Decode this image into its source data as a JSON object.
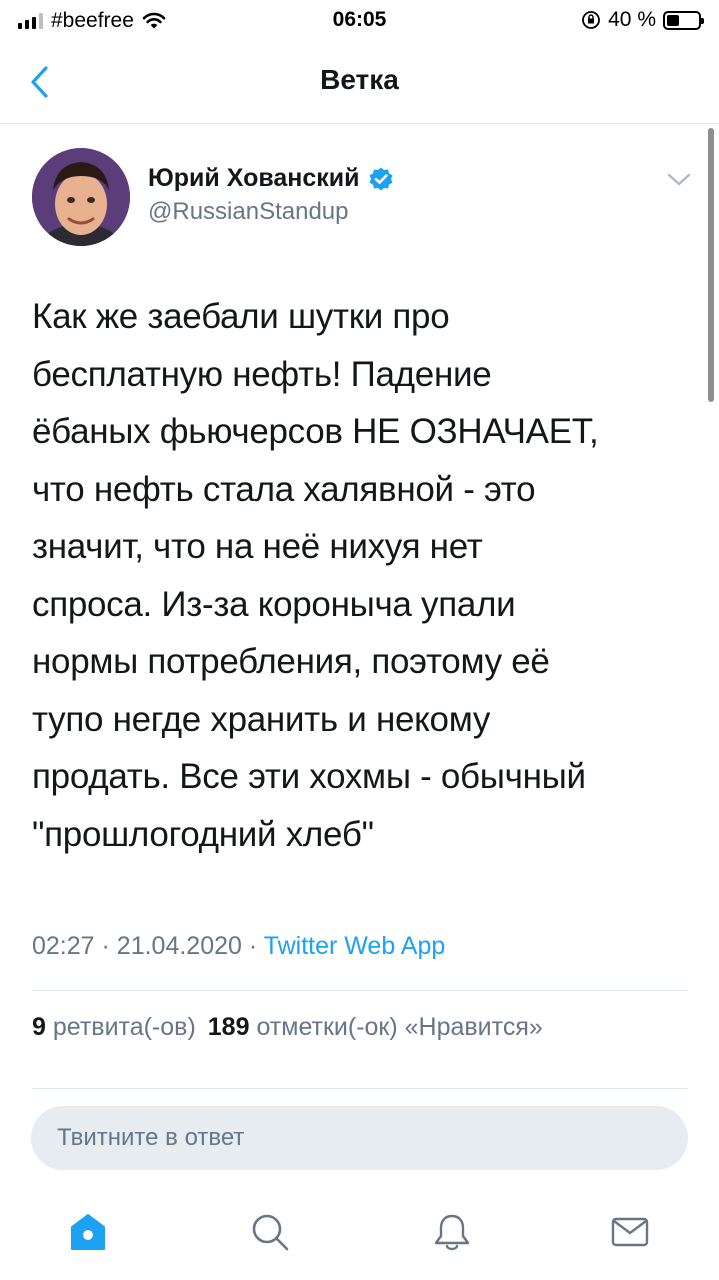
{
  "status_bar": {
    "carrier": "#beefree",
    "time": "06:05",
    "battery_percent": "40 %",
    "battery_level": 0.4
  },
  "nav": {
    "title": "Ветка",
    "back_icon": "chevron-left-icon"
  },
  "tweet": {
    "author_name": "Юрий Хованский",
    "author_handle": "@RussianStandup",
    "verified": true,
    "text": "Как же заебали шутки про\nбесплатную нефть! Падение\nёбаных фьючерсов НЕ ОЗНАЧАЕТ,\nчто нефть стала халявной - это\nзначит, что на неё нихуя нет\nспроса. Из-за короныча упали\nнормы потребления, поэтому её\nтупо негде хранить и некому\nпродать. Все эти хохмы - обычный\n\"прошлогодний хлеб\"",
    "time": "02:27",
    "date": "21.04.2020",
    "source": "Twitter Web App",
    "separator": "·",
    "retweets_count": "9",
    "retweets_label": "ретвита(-ов)",
    "likes_count": "189",
    "likes_label": "отметки(-ок) «Нравится»"
  },
  "reply": {
    "placeholder": "Твитните в ответ"
  },
  "tabs": [
    {
      "name": "home",
      "icon": "home-icon",
      "active": true
    },
    {
      "name": "search",
      "icon": "search-icon",
      "active": false
    },
    {
      "name": "notifications",
      "icon": "bell-icon",
      "active": false
    },
    {
      "name": "messages",
      "icon": "envelope-icon",
      "active": false
    }
  ],
  "colors": {
    "accent": "#1da1f2",
    "text": "#14171a",
    "secondary_text": "#657786",
    "divider": "#e1e8ed",
    "reply_bg": "#e6ecf0"
  }
}
